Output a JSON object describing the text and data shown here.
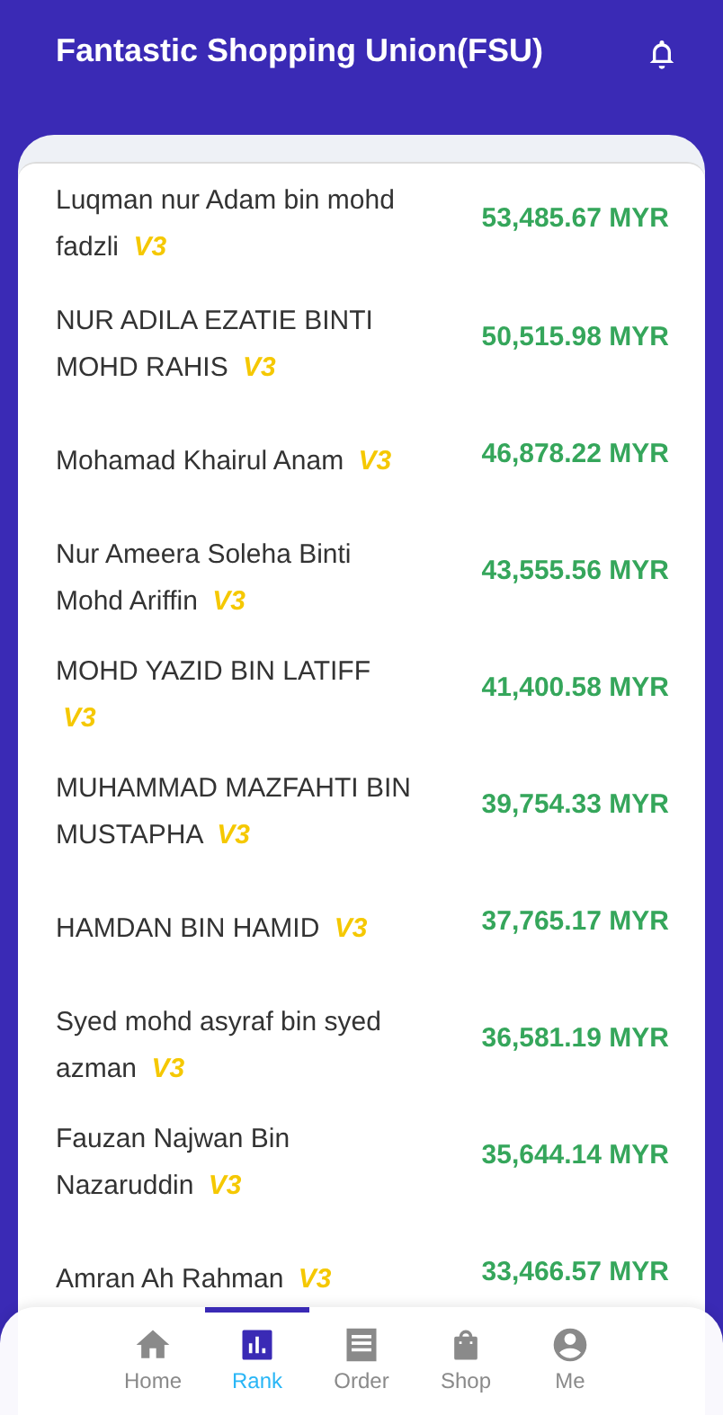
{
  "header": {
    "title": "Fantastic Shopping Union(FSU)"
  },
  "ranking": [
    {
      "name": "Luqman nur Adam bin mohd fadzli",
      "badge": "V3",
      "amount": "53,485.67 MYR"
    },
    {
      "name": "NUR ADILA EZATIE BINTI MOHD RAHIS",
      "badge": "V3",
      "amount": "50,515.98 MYR"
    },
    {
      "name": "Mohamad Khairul Anam",
      "badge": "V3",
      "amount": "46,878.22 MYR"
    },
    {
      "name": "Nur Ameera Soleha Binti Mohd Ariffin",
      "badge": "V3",
      "amount": "43,555.56 MYR"
    },
    {
      "name": "MOHD YAZID BIN LATIFF",
      "badge": "V3",
      "amount": "41,400.58 MYR"
    },
    {
      "name": "MUHAMMAD MAZFAHTI BIN MUSTAPHA",
      "badge": "V3",
      "amount": "39,754.33 MYR"
    },
    {
      "name": "HAMDAN BIN HAMID",
      "badge": "V3",
      "amount": "37,765.17 MYR"
    },
    {
      "name": "Syed mohd asyraf bin syed azman",
      "badge": "V3",
      "amount": "36,581.19 MYR"
    },
    {
      "name": "Fauzan Najwan Bin Nazaruddin",
      "badge": "V3",
      "amount": "35,644.14 MYR"
    },
    {
      "name": "Amran Ah Rahman",
      "badge": "V3",
      "amount": "33,466.57 MYR"
    }
  ],
  "tab_bar": [
    {
      "label": "Home",
      "kind": "home",
      "selected": false
    },
    {
      "label": "Rank",
      "kind": "rank",
      "selected": true
    },
    {
      "label": "Order",
      "kind": "order",
      "selected": false
    },
    {
      "label": "Shop",
      "kind": "shop",
      "selected": false
    },
    {
      "label": "Me",
      "kind": "me",
      "selected": false
    }
  ]
}
